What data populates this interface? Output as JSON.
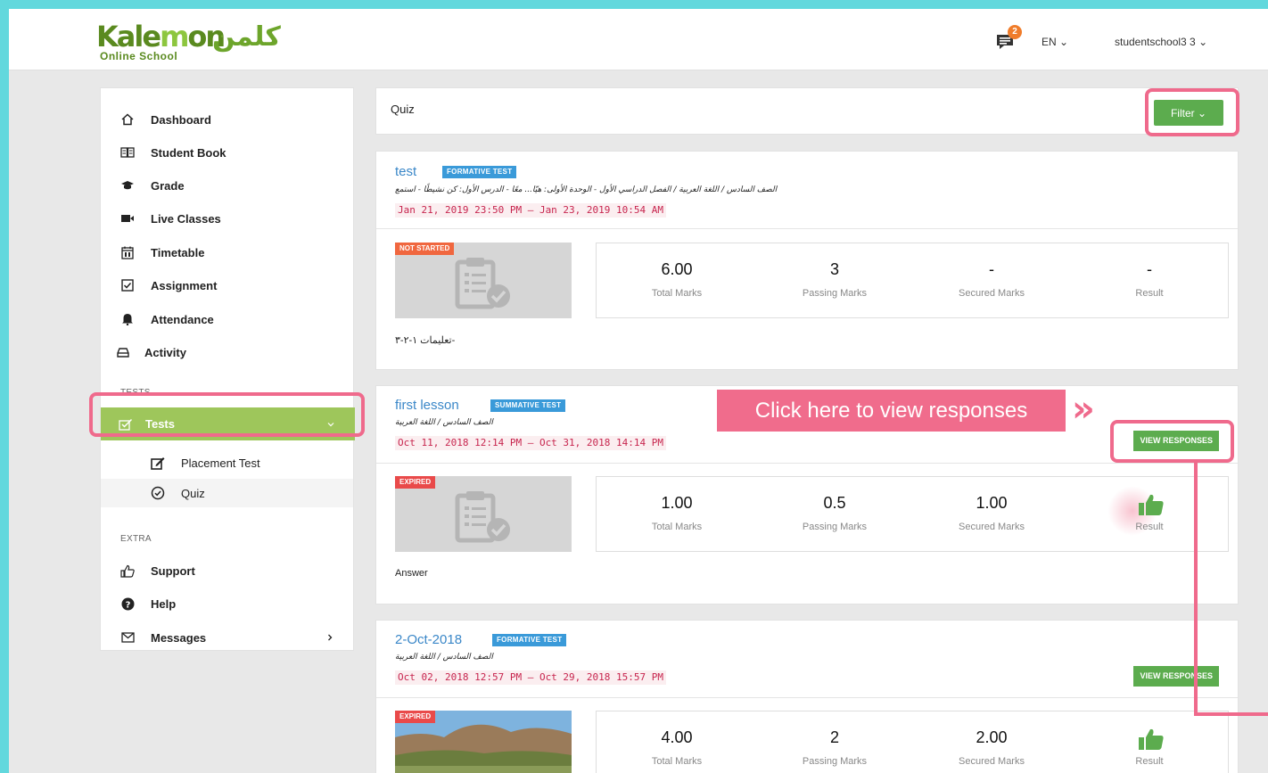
{
  "header": {
    "logo_text": "Kalemon",
    "logo_subtitle": "Online School",
    "logo_arabic": "كلمن",
    "notification_count": "2",
    "language": "EN ⌄",
    "user": "studentschool3 3 ⌄"
  },
  "sidebar": {
    "items": [
      {
        "label": "Dashboard",
        "icon": "home-icon"
      },
      {
        "label": "Student Book",
        "icon": "book-icon"
      },
      {
        "label": "Grade",
        "icon": "graduation-cap-icon"
      },
      {
        "label": "Live Classes",
        "icon": "video-icon"
      },
      {
        "label": "Timetable",
        "icon": "calendar-icon"
      },
      {
        "label": "Assignment",
        "icon": "checkbox-icon"
      },
      {
        "label": "Attendance",
        "icon": "bell-icon"
      },
      {
        "label": "Activity",
        "icon": "tray-icon"
      }
    ],
    "tests_section_label": "TESTS",
    "tests_label": "Tests",
    "sub_items": [
      {
        "label": "Placement Test",
        "icon": "edit-icon"
      },
      {
        "label": "Quiz",
        "icon": "check-circle-icon"
      }
    ],
    "extra_section_label": "EXTRA",
    "extra_items": [
      {
        "label": "Support",
        "icon": "thumbs-up-icon"
      },
      {
        "label": "Help",
        "icon": "help-icon"
      },
      {
        "label": "Messages",
        "icon": "envelope-icon"
      }
    ]
  },
  "page": {
    "title": "Quiz",
    "filter_label": "Filter ⌄"
  },
  "quizzes": [
    {
      "title": "test",
      "type": "FORMATIVE TEST",
      "breadcrumb": "الصف السادس / اللغة العربية / الفصل الدراسي الأول - الوحدة الأولى: هيّا... معًا - الدرس الأول: كن نشيطًا - استمع",
      "date_range": "Jan 21, 2019 23:50 PM – Jan 23, 2019 10:54 AM",
      "status": "NOT STARTED",
      "total_marks": "6.00",
      "passing_marks": "3",
      "secured_marks": "-",
      "result": "-",
      "note": "تعليمات ١-٢-٣-"
    },
    {
      "title": "first lesson",
      "type": "SUMMATIVE TEST",
      "breadcrumb": "الصف السادس / اللغة العربية",
      "date_range": "Oct 11, 2018 12:14 PM – Oct 31, 2018 14:14 PM",
      "status": "EXPIRED",
      "total_marks": "1.00",
      "passing_marks": "0.5",
      "secured_marks": "1.00",
      "result_icon": "thumbs-up-icon",
      "note": "Answer",
      "view_label": "VIEW RESPONSES"
    },
    {
      "title": "2-Oct-2018",
      "type": "FORMATIVE TEST",
      "breadcrumb": "الصف السادس / اللغة العربية",
      "date_range": "Oct 02, 2018 12:57 PM – Oct 29, 2018 15:57 PM",
      "status": "EXPIRED",
      "total_marks": "4.00",
      "passing_marks": "2",
      "secured_marks": "2.00",
      "result_icon": "thumbs-up-icon",
      "view_label": "VIEW RESPONSES"
    }
  ],
  "labels": {
    "total_marks": "Total Marks",
    "passing_marks": "Passing Marks",
    "secured_marks": "Secured Marks",
    "result": "Result"
  },
  "annotation": {
    "callout": "Click here to view responses",
    "arrow": "»"
  },
  "colors": {
    "accent_green": "#5cac4e",
    "sidebar_active": "#9ec65b",
    "link_blue": "#3a87c8",
    "highlight_pink": "#ef6a8c",
    "frame_cyan": "#62d8dd"
  }
}
